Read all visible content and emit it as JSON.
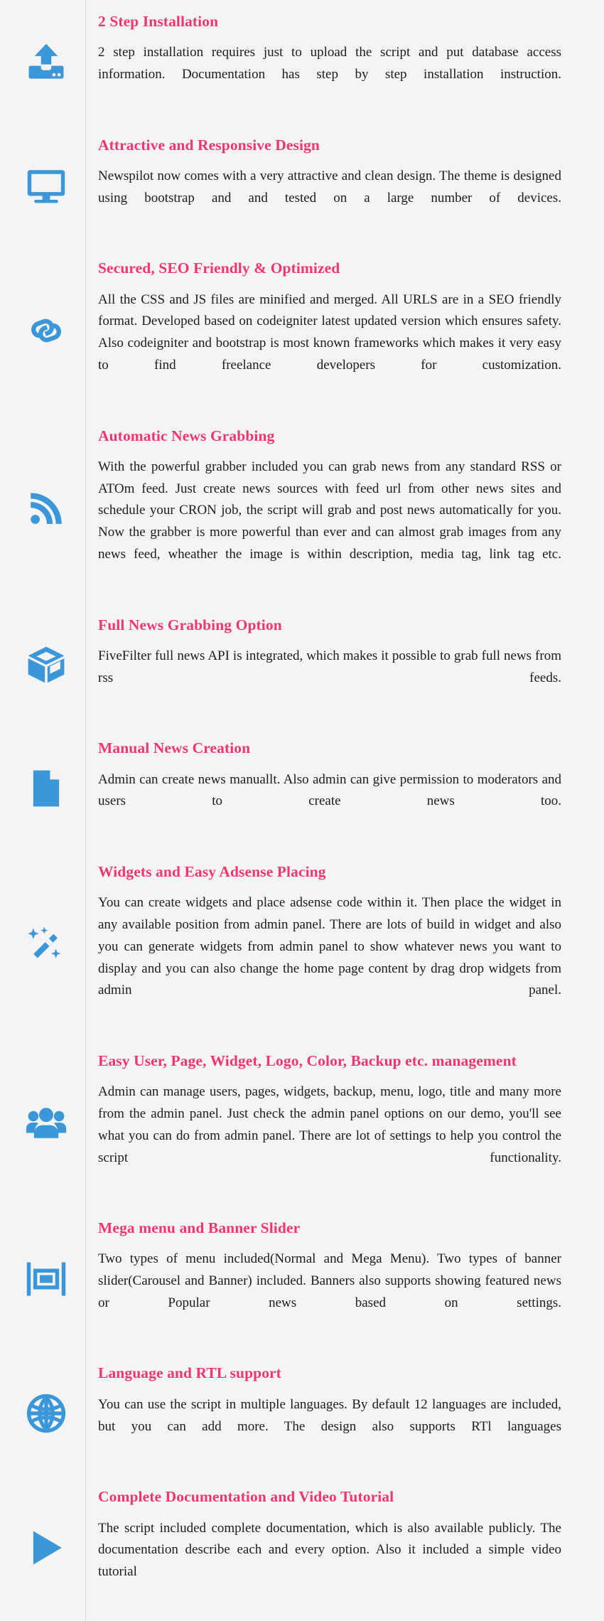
{
  "page": {
    "background_color": "#f4f4f4",
    "title_color": "#f1356d",
    "icon_color": "#3b97d8",
    "body_text_color": "#1c1c1c"
  },
  "features": [
    {
      "icon": "upload-icon",
      "title": "2 Step Installation",
      "description": "2 step installation requires just to upload the script and put database access information. Documentation has step by step installation instruction."
    },
    {
      "icon": "desktop-monitor-icon",
      "title": "Attractive and Responsive Design",
      "description": "Newspilot now comes with a very attractive and clean design. The theme is designed using bootstrap and and tested on a large number of devices."
    },
    {
      "icon": "link-chain-icon",
      "title": "Secured, SEO Friendly & Optimized",
      "description": "All the CSS and JS files are minified and merged. All URLS are in a SEO friendly format. Developed based on codeigniter latest updated version which ensures safety. Also codeigniter and bootstrap is most known frameworks which makes it very easy to find freelance developers for customization."
    },
    {
      "icon": "rss-feed-icon",
      "title": "Automatic News Grabbing",
      "description": "With the powerful grabber included you can grab news from any standard RSS or ATOm feed. Just create news sources with feed url from other news sites and schedule your CRON job, the script will grab and post news automatically for you. Now the grabber is more powerful than ever and can almost grab images from any news feed, wheather the image is within description, media tag, link tag etc."
    },
    {
      "icon": "cube-box-icon",
      "title": "Full News Grabbing Option",
      "description": "FiveFilter full news API is integrated, which makes it possible to grab full news from rss feeds."
    },
    {
      "icon": "document-file-icon",
      "title": "Manual News Creation",
      "description": "Admin can create news manuallt. Also admin can give permission to moderators and users to create news too."
    },
    {
      "icon": "magic-wand-icon",
      "title": "Widgets and Easy Adsense Placing",
      "description": "You can create widgets and place adsense code within it. Then place the widget in any available position from admin panel. There are lots of build in widget and also you can generate widgets from admin panel to show whatever news you want to display and you can also change the home page content by drag drop widgets from admin panel."
    },
    {
      "icon": "users-group-icon",
      "title": "Easy User, Page, Widget, Logo, Color, Backup etc. management",
      "description": "Admin can manage users, pages, widgets, backup, menu, logo, title and many more from the admin panel. Just check the admin panel options on our demo, you'll see what you can do from admin panel. There are lot of settings to help you control the script functionality."
    },
    {
      "icon": "image-frame-icon",
      "title": "Mega menu and Banner Slider",
      "description": "Two types of menu included(Normal and Mega Menu). Two types of banner slider(Carousel and Banner) included. Banners also supports showing featured news or Popular news based on settings."
    },
    {
      "icon": "globe-icon",
      "title": "Language and RTL support",
      "description": "You can use the script in multiple languages. By default 12 languages are included, but you can add more. The design also supports RTl languages"
    },
    {
      "icon": "play-button-icon",
      "title": "Complete Documentation and Video Tutorial",
      "description": "The script included complete documentation, which is also available publicly. The documentation describe each and every option. Also it included a simple video tutorial"
    }
  ]
}
